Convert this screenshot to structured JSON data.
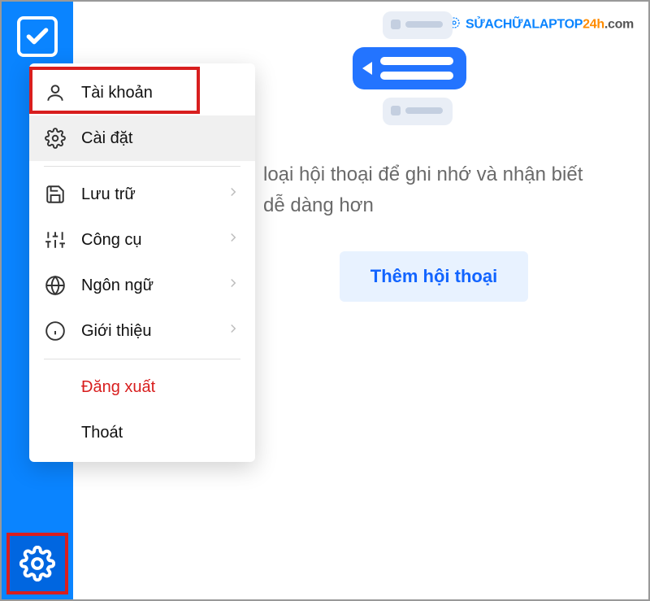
{
  "menu": {
    "account": "Tài khoản",
    "settings": "Cài đặt",
    "storage": "Lưu trữ",
    "tools": "Công cụ",
    "language": "Ngôn ngữ",
    "about": "Giới thiệu",
    "logout": "Đăng xuất",
    "exit": "Thoát"
  },
  "main": {
    "hint": "loại hội thoại để ghi nhớ và nhận biết dễ dàng hơn",
    "add_button": "Thêm hội thoại"
  },
  "watermark": {
    "brand_blue": "SỬACHỮALAPTOP",
    "brand_orange": "24h",
    "brand_grey": ".com"
  },
  "icons": {
    "check": "check-icon",
    "gear": "gear-icon",
    "user": "user-icon",
    "save": "save-icon",
    "sliders": "sliders-icon",
    "globe": "globe-icon",
    "info": "info-icon",
    "chevron": "chevron-right-icon"
  },
  "colors": {
    "primary_blue": "#0a84ff",
    "highlight_red": "#d81e1e",
    "logout_red": "#d81e1e",
    "button_blue": "#1264ff",
    "button_bg": "#e8f2ff"
  }
}
